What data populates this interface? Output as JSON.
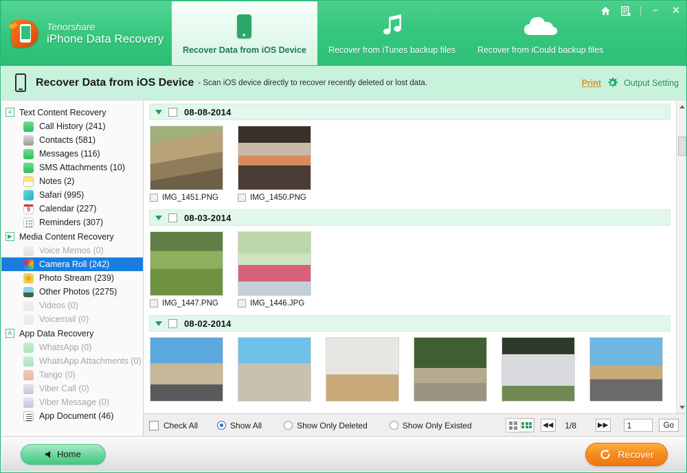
{
  "window": {
    "controls": [
      {
        "name": "home-icon",
        "glyph": "⌂"
      },
      {
        "name": "feedback-icon",
        "glyph": "🗒"
      },
      {
        "name": "minimize",
        "glyph": "−"
      },
      {
        "name": "close",
        "glyph": "✕"
      }
    ]
  },
  "brand": {
    "company": "Tenorshare",
    "product": "iPhone Data Recovery"
  },
  "tabs": [
    {
      "label": "Recover Data from iOS Device",
      "icon": "device-icon",
      "active": true
    },
    {
      "label": "Recover from iTunes backup files",
      "icon": "music-note-icon",
      "active": false
    },
    {
      "label": "Recover from iCould backup files",
      "icon": "cloud-icon",
      "active": false
    }
  ],
  "subheader": {
    "title": "Recover Data from iOS Device",
    "description": "- Scan iOS device directly to recover recently deleted or lost data.",
    "print_label": "Print",
    "output_setting_label": "Output Setting"
  },
  "sidebar": {
    "groups": [
      {
        "label": "Text Content Recovery",
        "marker": "≡",
        "items": [
          {
            "label": "Call History (241)",
            "icon": "phone-icon",
            "cls": "ic-call",
            "disabled": false,
            "selected": false
          },
          {
            "label": "Contacts (581)",
            "icon": "contacts-icon",
            "cls": "ic-contacts",
            "disabled": false,
            "selected": false
          },
          {
            "label": "Messages (116)",
            "icon": "messages-icon",
            "cls": "ic-msg",
            "disabled": false,
            "selected": false
          },
          {
            "label": "SMS Attachments (10)",
            "icon": "paperclip-icon",
            "cls": "ic-sms",
            "disabled": false,
            "selected": false
          },
          {
            "label": "Notes (2)",
            "icon": "notes-icon",
            "cls": "ic-notes",
            "disabled": false,
            "selected": false
          },
          {
            "label": "Safari (995)",
            "icon": "safari-icon",
            "cls": "ic-safari",
            "disabled": false,
            "selected": false
          },
          {
            "label": "Calendar (227)",
            "icon": "calendar-icon",
            "cls": "ic-cal",
            "disabled": false,
            "selected": false
          },
          {
            "label": "Reminders (307)",
            "icon": "reminders-icon",
            "cls": "ic-rem",
            "disabled": false,
            "selected": false
          }
        ]
      },
      {
        "label": "Media Content Recovery",
        "marker": "▶",
        "items": [
          {
            "label": "Voice Memos (0)",
            "icon": "voice-memo-icon",
            "cls": "ic-voice",
            "disabled": true,
            "selected": false
          },
          {
            "label": "Camera Roll (242)",
            "icon": "camera-roll-icon",
            "cls": "ic-camera",
            "disabled": false,
            "selected": true
          },
          {
            "label": "Photo Stream (239)",
            "icon": "photo-stream-icon",
            "cls": "ic-photostream",
            "disabled": false,
            "selected": false
          },
          {
            "label": "Other Photos (2275)",
            "icon": "other-photos-icon",
            "cls": "ic-other",
            "disabled": false,
            "selected": false
          },
          {
            "label": "Videos (0)",
            "icon": "videos-icon",
            "cls": "ic-video",
            "disabled": true,
            "selected": false
          },
          {
            "label": "Voicemail (0)",
            "icon": "voicemail-icon",
            "cls": "ic-vm",
            "disabled": true,
            "selected": false
          }
        ]
      },
      {
        "label": "App Data Recovery",
        "marker": "A",
        "items": [
          {
            "label": "WhatsApp (0)",
            "icon": "whatsapp-icon",
            "cls": "ic-wa",
            "disabled": true,
            "selected": false
          },
          {
            "label": "WhatsApp Attachments (0)",
            "icon": "whatsapp-attachments-icon",
            "cls": "ic-waa",
            "disabled": true,
            "selected": false
          },
          {
            "label": "Tango (0)",
            "icon": "tango-icon",
            "cls": "ic-tango",
            "disabled": true,
            "selected": false
          },
          {
            "label": "Viber Call (0)",
            "icon": "viber-call-icon",
            "cls": "ic-viberc",
            "disabled": true,
            "selected": false
          },
          {
            "label": "Viber Message (0)",
            "icon": "viber-message-icon",
            "cls": "ic-viberm",
            "disabled": true,
            "selected": false
          },
          {
            "label": "App Document (46)",
            "icon": "app-document-icon",
            "cls": "ic-appdoc",
            "disabled": false,
            "selected": false
          }
        ]
      }
    ]
  },
  "gallery": {
    "groups": [
      {
        "date": "08-08-2014",
        "expanded": true,
        "checked": false,
        "items": [
          {
            "name": "IMG_1451.PNG",
            "checked": false,
            "art": "porch"
          },
          {
            "name": "IMG_1450.PNG",
            "checked": false,
            "art": "dinner"
          }
        ]
      },
      {
        "date": "08-03-2014",
        "expanded": true,
        "checked": false,
        "items": [
          {
            "name": "IMG_1447.PNG",
            "checked": false,
            "art": "stroller"
          },
          {
            "name": "IMG_1446.JPG",
            "checked": false,
            "art": "girls"
          }
        ]
      },
      {
        "date": "08-02-2014",
        "expanded": true,
        "checked": false,
        "items": [
          {
            "name": "",
            "checked": false,
            "art": "town"
          },
          {
            "name": "",
            "checked": false,
            "art": "carnival"
          },
          {
            "name": "",
            "checked": false,
            "art": "playroom"
          },
          {
            "name": "",
            "checked": false,
            "art": "house-trees"
          },
          {
            "name": "",
            "checked": false,
            "art": "house-gray"
          },
          {
            "name": "",
            "checked": false,
            "art": "palm-road"
          }
        ]
      }
    ]
  },
  "filterbar": {
    "check_all_label": "Check All",
    "check_all_checked": false,
    "options": [
      {
        "label": "Show All",
        "selected": true
      },
      {
        "label": "Show Only Deleted",
        "selected": false
      },
      {
        "label": "Show Only Existed",
        "selected": false
      }
    ],
    "view_modes": [
      {
        "name": "list-view",
        "active": false
      },
      {
        "name": "grid-view",
        "active": true
      }
    ],
    "prev_glyph": "◀◀",
    "next_glyph": "▶▶",
    "page_indicator": "1/8",
    "page_input_value": "1",
    "go_label": "Go"
  },
  "footer": {
    "home_label": "Home",
    "recover_label": "Recover"
  },
  "colors": {
    "brand_green": "#2fc077",
    "accent_orange": "#f58a1f",
    "selection_blue": "#1a7ee0",
    "print_link": "#d9902a"
  }
}
